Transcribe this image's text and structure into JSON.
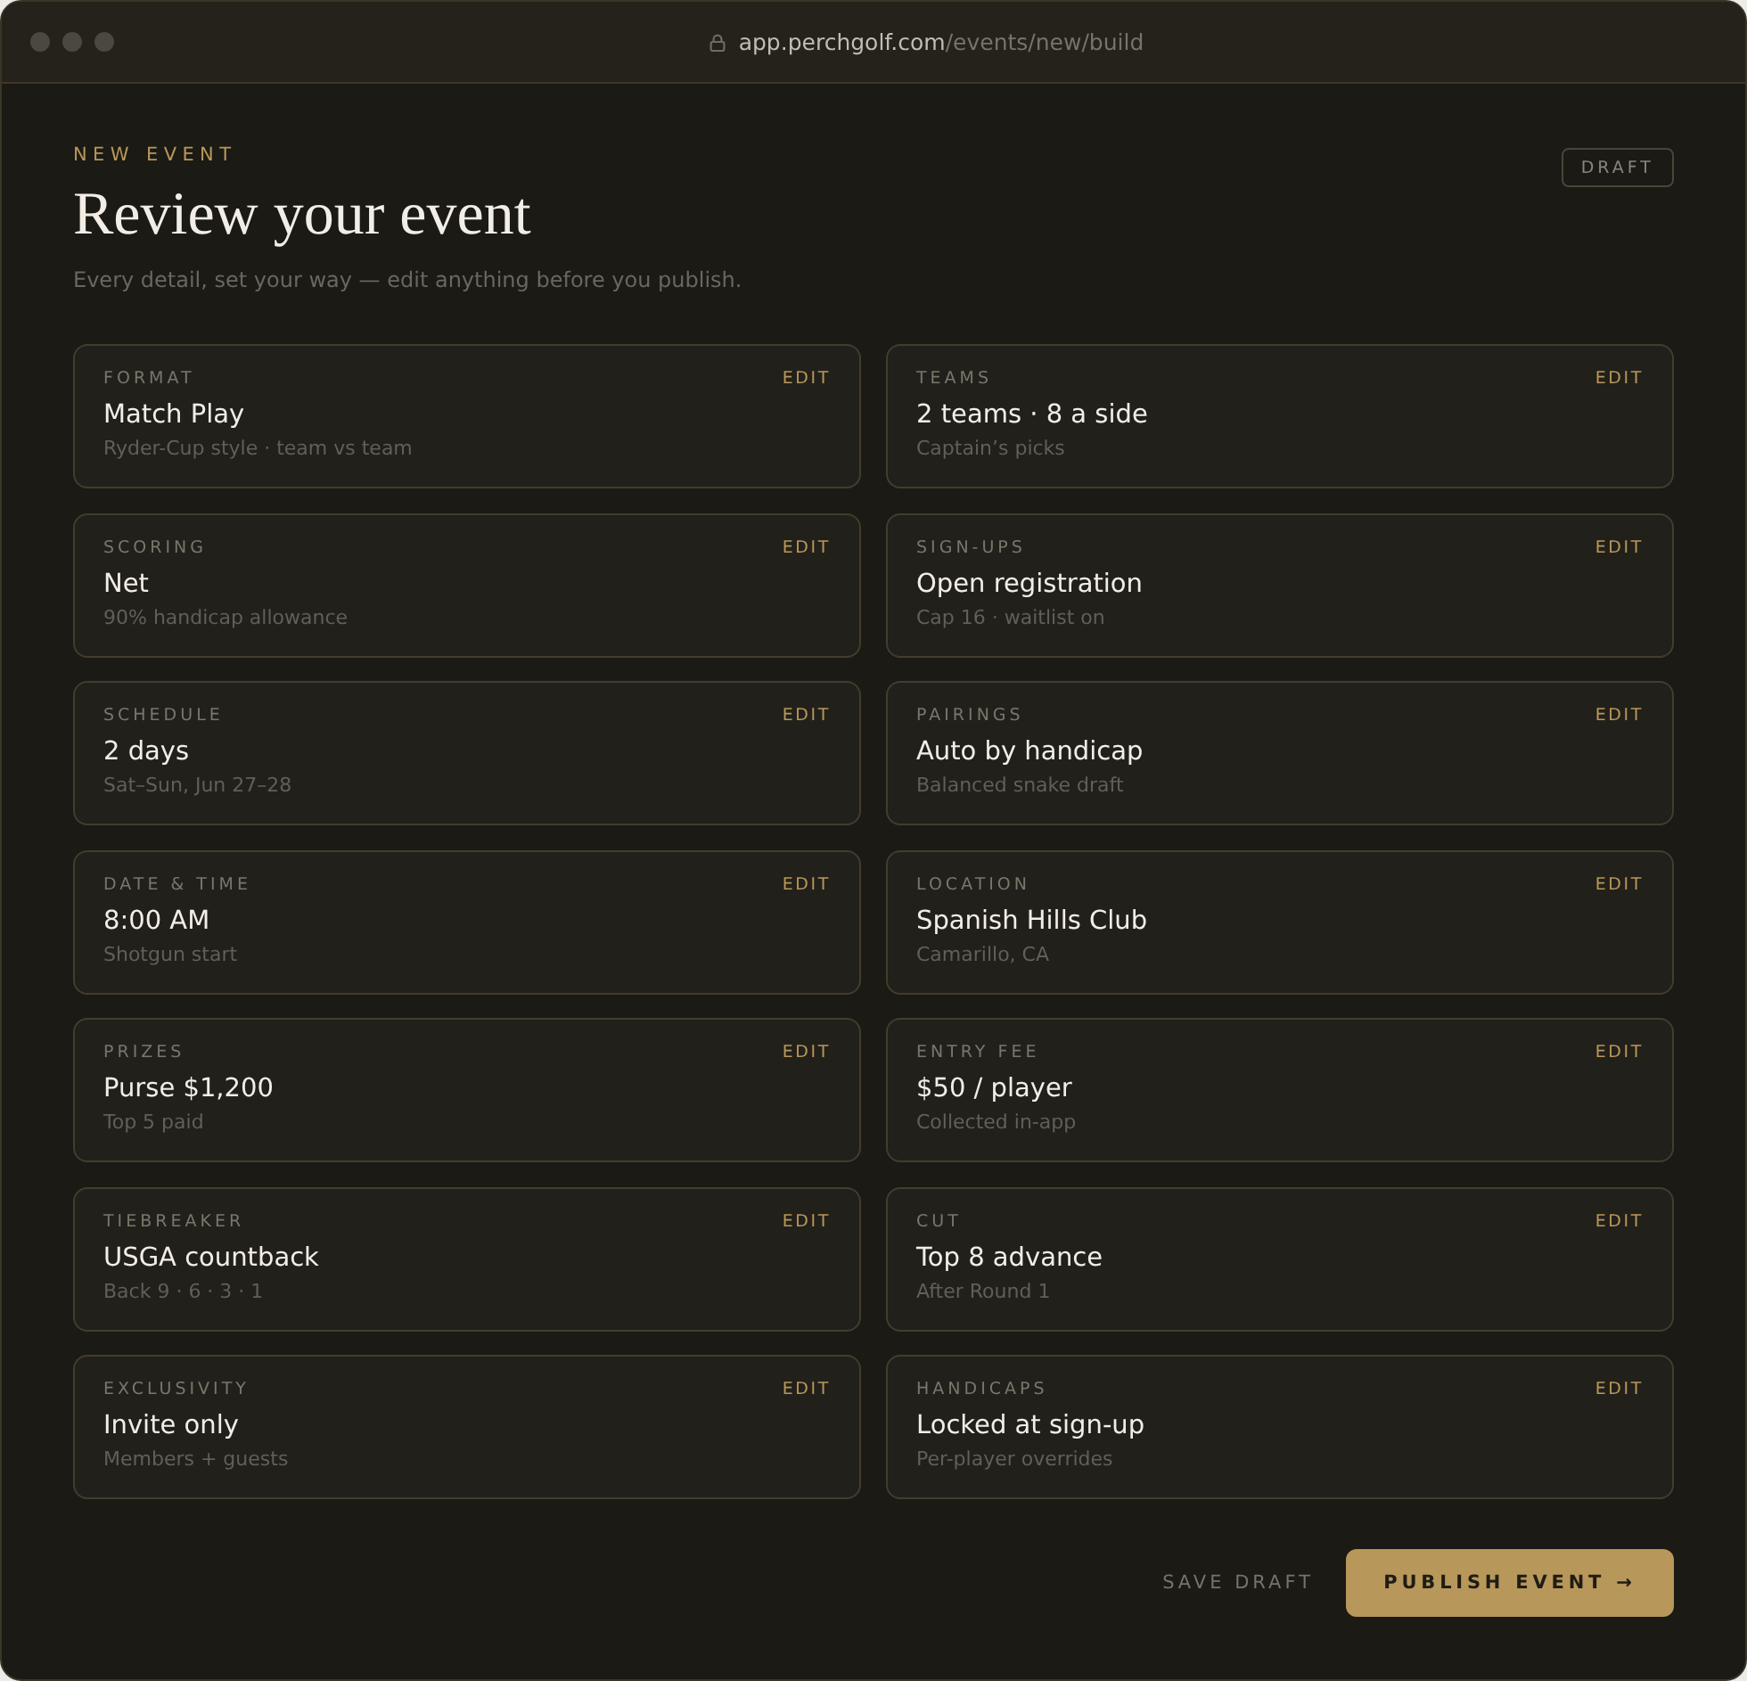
{
  "browser": {
    "url_host": "app.perchgolf.com",
    "url_path": "/events/new/build"
  },
  "header": {
    "eyebrow": "NEW EVENT",
    "title": "Review your event",
    "subtitle": "Every detail, set your way — edit anything before you publish.",
    "status_badge": "DRAFT"
  },
  "cards": [
    {
      "label": "FORMAT",
      "value": "Match Play",
      "detail": "Ryder-Cup style · team vs team",
      "action": "EDIT"
    },
    {
      "label": "TEAMS",
      "value": "2 teams · 8 a side",
      "detail": "Captain’s picks",
      "action": "EDIT"
    },
    {
      "label": "SCORING",
      "value": "Net",
      "detail": "90% handicap allowance",
      "action": "EDIT"
    },
    {
      "label": "SIGN-UPS",
      "value": "Open registration",
      "detail": "Cap 16 · waitlist on",
      "action": "EDIT"
    },
    {
      "label": "SCHEDULE",
      "value": "2 days",
      "detail": "Sat–Sun, Jun 27–28",
      "action": "EDIT"
    },
    {
      "label": "PAIRINGS",
      "value": "Auto by handicap",
      "detail": "Balanced snake draft",
      "action": "EDIT"
    },
    {
      "label": "DATE & TIME",
      "value": "8:00 AM",
      "detail": "Shotgun start",
      "action": "EDIT"
    },
    {
      "label": "LOCATION",
      "value": "Spanish Hills Club",
      "detail": "Camarillo, CA",
      "action": "EDIT"
    },
    {
      "label": "PRIZES",
      "value": "Purse $1,200",
      "detail": "Top 5 paid",
      "action": "EDIT"
    },
    {
      "label": "ENTRY FEE",
      "value": "$50 / player",
      "detail": "Collected in-app",
      "action": "EDIT"
    },
    {
      "label": "TIEBREAKER",
      "value": "USGA countback",
      "detail": "Back 9 · 6 · 3 · 1",
      "action": "EDIT"
    },
    {
      "label": "CUT",
      "value": "Top 8 advance",
      "detail": "After Round 1",
      "action": "EDIT"
    },
    {
      "label": "EXCLUSIVITY",
      "value": "Invite only",
      "detail": "Members + guests",
      "action": "EDIT"
    },
    {
      "label": "HANDICAPS",
      "value": "Locked at sign-up",
      "detail": "Per-player overrides",
      "action": "EDIT"
    }
  ],
  "footer": {
    "secondary_action": "SAVE DRAFT",
    "primary_action": "PUBLISH EVENT →"
  }
}
